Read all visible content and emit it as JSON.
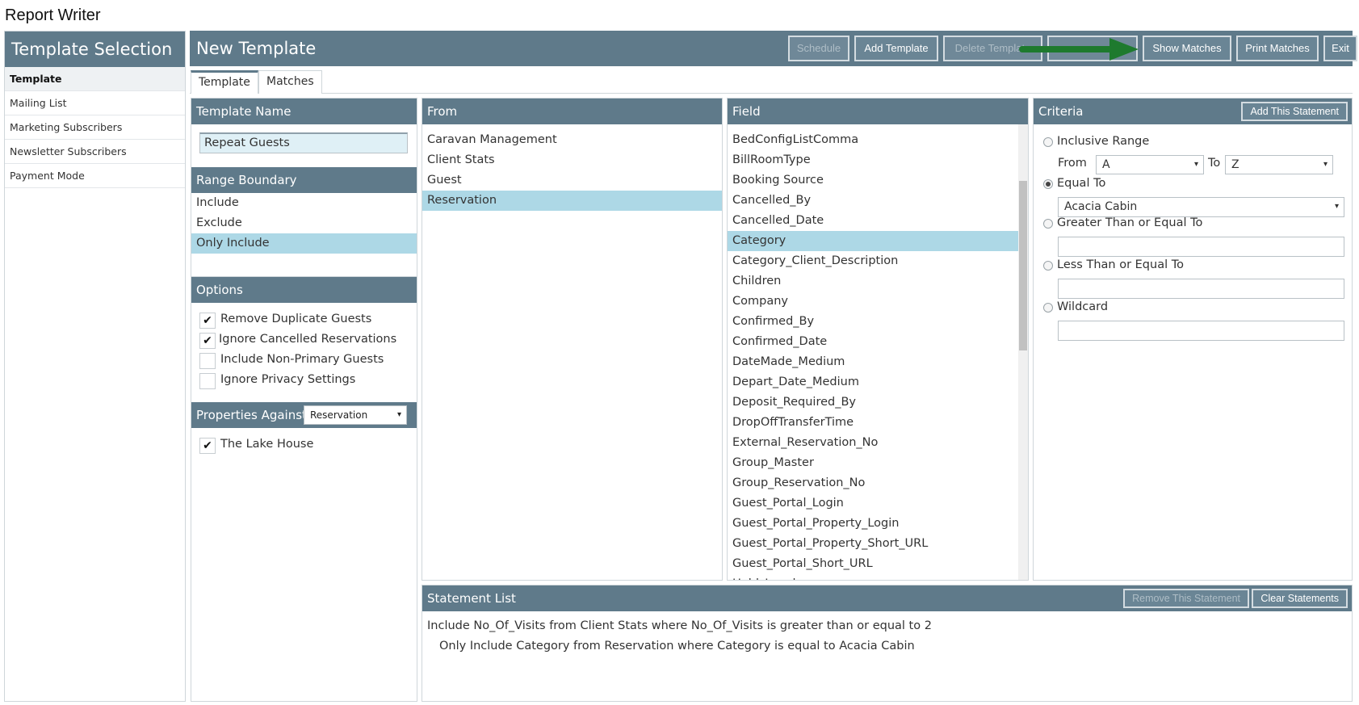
{
  "app_title": "Report Writer",
  "left": {
    "header": "Template Selection",
    "items": [
      {
        "label": "Template"
      },
      {
        "label": "Mailing List"
      },
      {
        "label": "Marketing Subscribers"
      },
      {
        "label": "Newsletter Subscribers"
      },
      {
        "label": "Payment Mode"
      }
    ]
  },
  "header": {
    "title": "New Template",
    "buttons": {
      "schedule": "Schedule",
      "add_template": "Add Template",
      "delete_template": "Delete Template",
      "hidden": "Save Template",
      "show_matches": "Show Matches",
      "print_matches": "Print Matches",
      "exit": "Exit"
    }
  },
  "tabs": {
    "template": "Template",
    "matches": "Matches"
  },
  "template_name": {
    "label": "Template Name",
    "value": "Repeat Guests"
  },
  "range_boundary": {
    "label": "Range Boundary",
    "items": [
      "Include",
      "Exclude",
      "Only Include"
    ]
  },
  "options": {
    "label": "Options",
    "items": [
      {
        "label": "Remove Duplicate Guests",
        "mark": "✔"
      },
      {
        "label": "Ignore Cancelled Reservations",
        "mark": "✔"
      },
      {
        "label": "Include Non-Primary Guests",
        "mark": ""
      },
      {
        "label": "Ignore Privacy Settings",
        "mark": ""
      }
    ]
  },
  "properties": {
    "label": "Properties Against",
    "select_value": "Reservation",
    "items": [
      {
        "label": "The Lake House",
        "mark": "✔"
      }
    ]
  },
  "from": {
    "label": "From",
    "items": [
      "Caravan Management",
      "Client Stats",
      "Guest",
      "Reservation"
    ]
  },
  "field": {
    "label": "Field",
    "items": [
      "BedConfigListComma",
      "BillRoomType",
      "Booking Source",
      "Cancelled_By",
      "Cancelled_Date",
      "Category",
      "Category_Client_Description",
      "Children",
      "Company",
      "Confirmed_By",
      "Confirmed_Date",
      "DateMade_Medium",
      "Depart_Date_Medium",
      "Deposit_Required_By",
      "DropOffTransferTime",
      "External_Reservation_No",
      "Group_Master",
      "Group_Reservation_No",
      "Guest_Portal_Login",
      "Guest_Portal_Property_Login",
      "Guest_Portal_Property_Short_URL",
      "Guest_Portal_Short_URL",
      "Hold_Level"
    ]
  },
  "criteria": {
    "label": "Criteria",
    "add_button": "Add This Statement",
    "inclusive_range": "Inclusive Range",
    "from_label": "From",
    "from_value": "A",
    "to_label": "To",
    "to_value": "Z",
    "equal_to": "Equal To",
    "equal_value": "Acacia Cabin",
    "gte": "Greater Than or Equal To",
    "lte": "Less Than or Equal To",
    "wildcard": "Wildcard"
  },
  "statements": {
    "label": "Statement List",
    "remove_button": "Remove This Statement",
    "clear_button": "Clear Statements",
    "items": [
      "Include No_Of_Visits from Client Stats where No_Of_Visits is greater than or equal to 2",
      "Only Include Category from Reservation where Category is equal to Acacia Cabin"
    ]
  },
  "caret": "▾",
  "colors": {
    "header": "#5f7a8a",
    "selection": "#add8e6",
    "arrow": "#1e7a2e"
  }
}
